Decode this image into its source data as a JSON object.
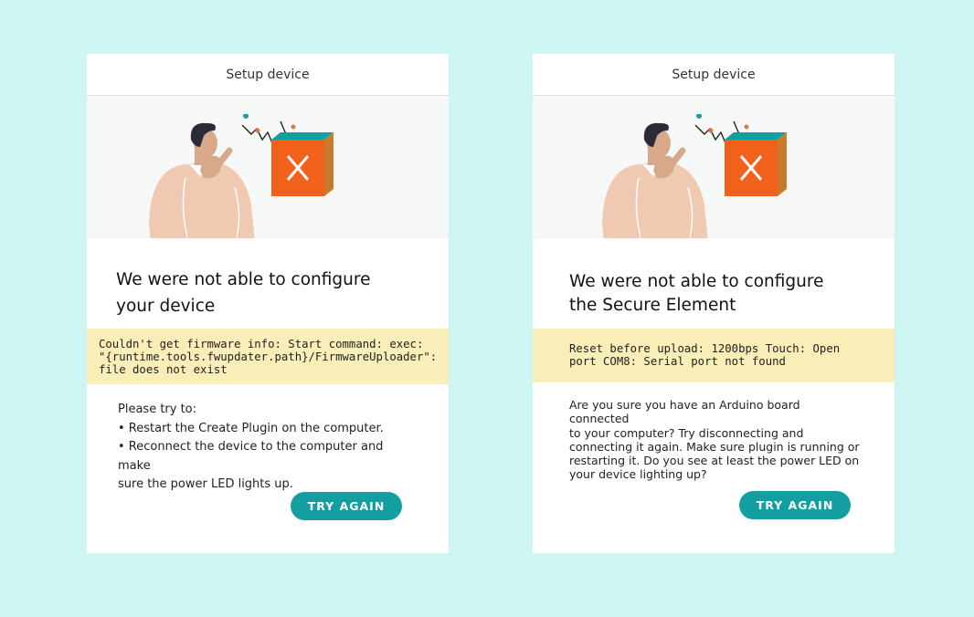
{
  "cards": [
    {
      "header_title": "Setup device",
      "heading": "We were not able to configure your device",
      "error_lines": [
        "Couldn't get firmware info: Start command: exec:",
        "\"{runtime.tools.fwupdater.path}/FirmwareUploader\":",
        "file does not exist"
      ],
      "help_lines": [
        "Please try to:",
        "• Restart the Create Plugin on the computer.",
        "• Reconnect the device to the computer and make",
        "sure the power LED lights up."
      ],
      "button_label": "TRY AGAIN"
    },
    {
      "header_title": "Setup device",
      "heading_lines": [
        "We were not able to configure",
        "the Secure Element"
      ],
      "error_lines": [
        "Reset before upload: 1200bps Touch: Open",
        "port COM8: Serial port not found"
      ],
      "help_lines": [
        "Are you sure you have an Arduino board connected",
        "to your computer? Try disconnecting and",
        "connecting it again. Make sure plugin is running or",
        "restarting it. Do you see at least the power LED on",
        "your device lighting up?"
      ],
      "button_label": "TRY AGAIN"
    }
  ],
  "colors": {
    "background": "#cdf5f2",
    "error_bg": "#f9edb8",
    "button": "#139ea2",
    "box_orange": "#f2611c"
  },
  "illustration": "confused-person-with-broken-box"
}
